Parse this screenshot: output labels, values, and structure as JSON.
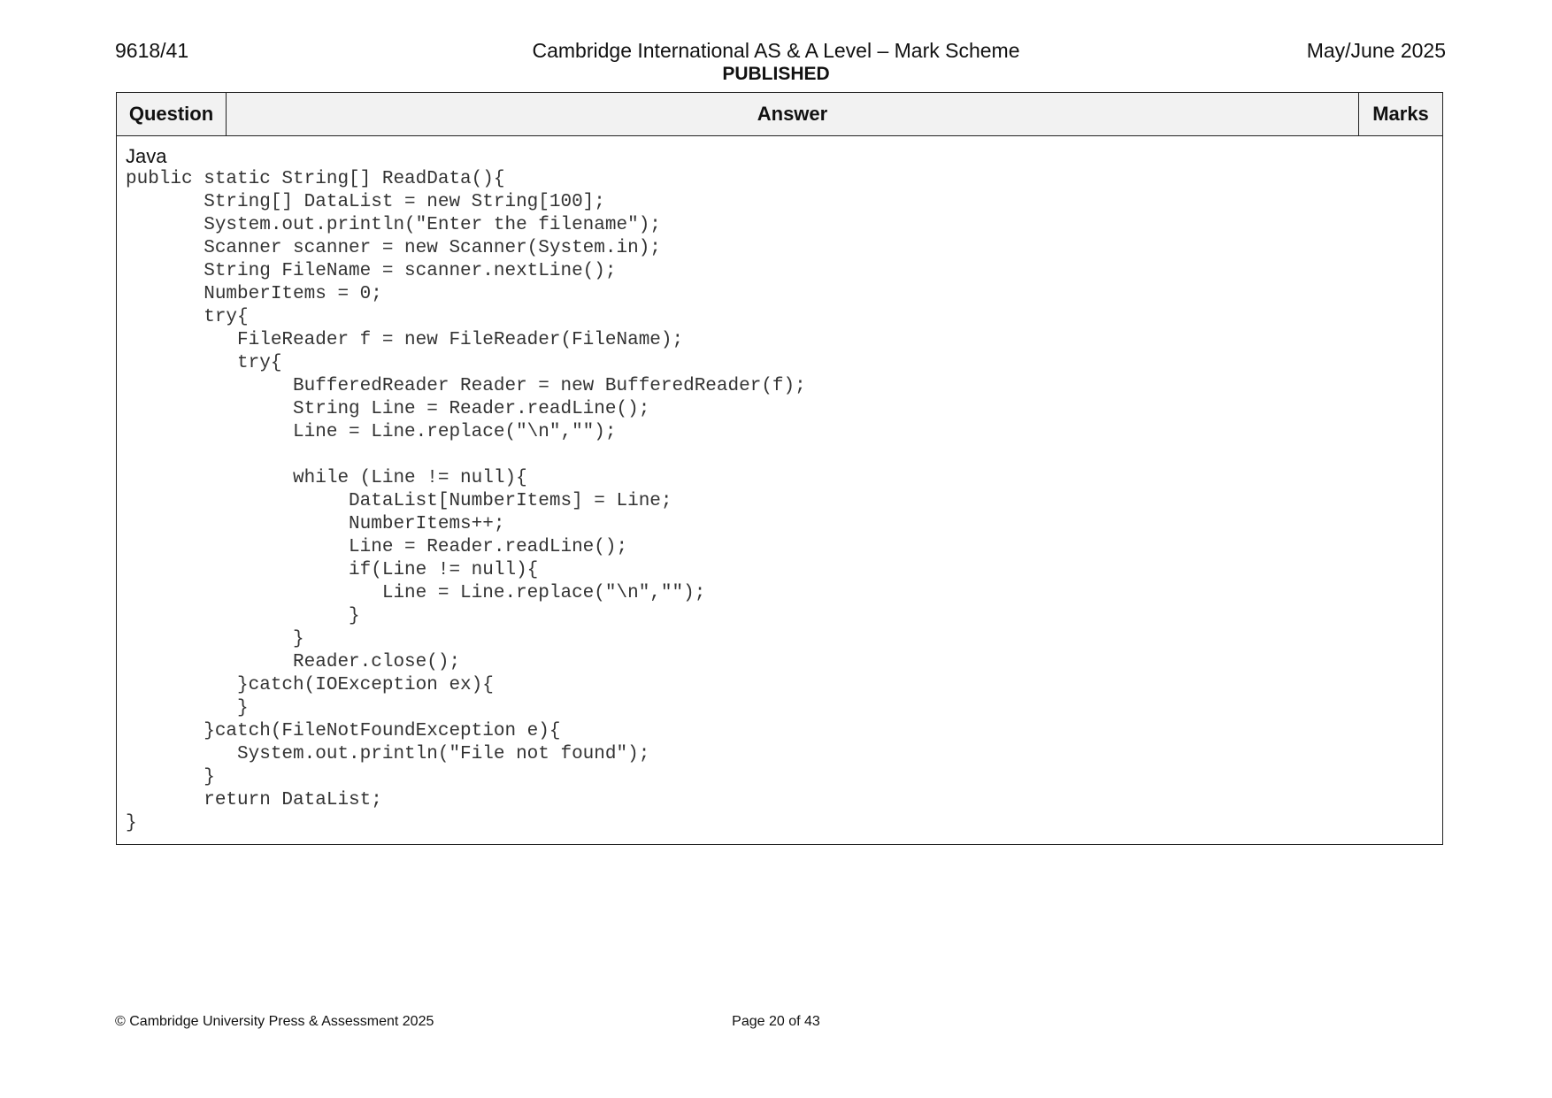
{
  "header": {
    "code": "9618/41",
    "title": "Cambridge International AS & A Level – Mark Scheme",
    "status": "PUBLISHED",
    "session": "May/June 2025"
  },
  "table": {
    "headers": {
      "question": "Question",
      "answer": "Answer",
      "marks": "Marks"
    },
    "language": "Java",
    "code_lines": [
      "public static String[] ReadData(){",
      "       String[] DataList = new String[100];",
      "       System.out.println(\"Enter the filename\");",
      "       Scanner scanner = new Scanner(System.in);",
      "       String FileName = scanner.nextLine();",
      "       NumberItems = 0;",
      "       try{",
      "          FileReader f = new FileReader(FileName);",
      "          try{",
      "               BufferedReader Reader = new BufferedReader(f);",
      "               String Line = Reader.readLine();",
      "               Line = Line.replace(\"\\n\",\"\");",
      "",
      "               while (Line != null){",
      "                    DataList[NumberItems] = Line;",
      "                    NumberItems++;",
      "                    Line = Reader.readLine();",
      "                    if(Line != null){",
      "                       Line = Line.replace(\"\\n\",\"\");",
      "                    }",
      "               }",
      "               Reader.close();",
      "          }catch(IOException ex){",
      "          }",
      "       }catch(FileNotFoundException e){",
      "          System.out.println(\"File not found\");",
      "       }",
      "       return DataList;",
      "}"
    ]
  },
  "footer": {
    "copyright": "© Cambridge University Press & Assessment 2025",
    "page": "Page 20 of 43"
  }
}
